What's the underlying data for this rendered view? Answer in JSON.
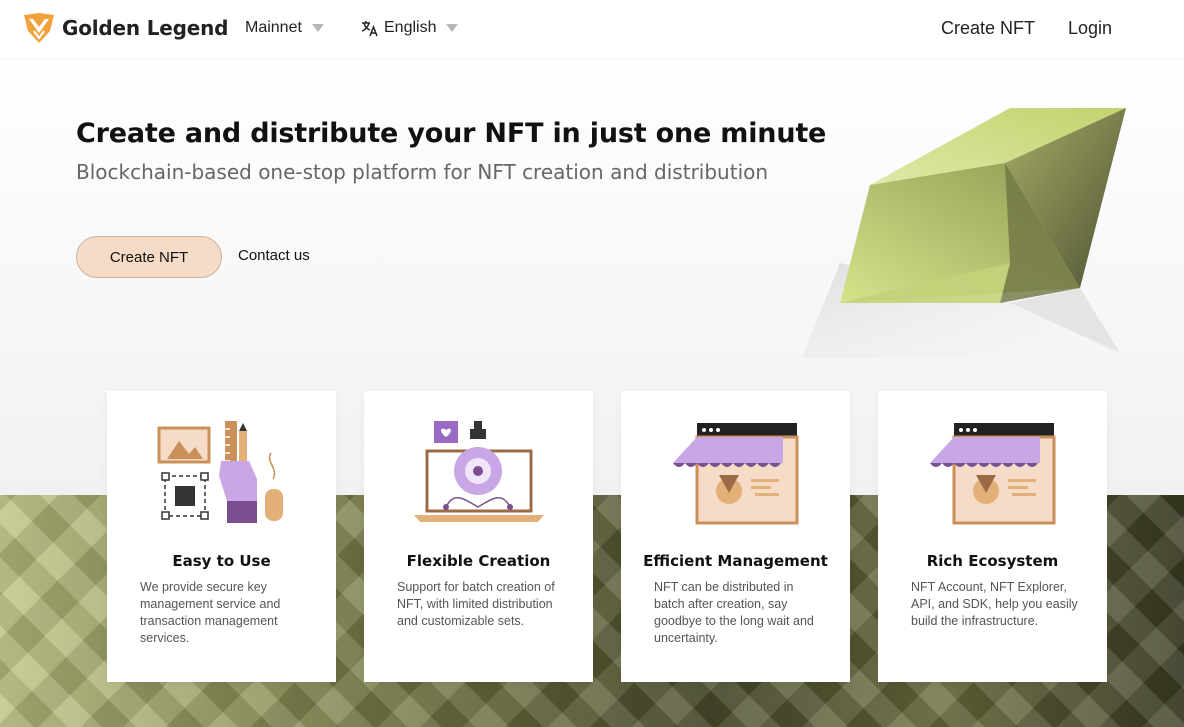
{
  "header": {
    "brand": "Golden Legend",
    "network": "Mainnet",
    "language": "English",
    "create_nft": "Create NFT",
    "login": "Login"
  },
  "hero": {
    "title": "Create and distribute your NFT in just one minute",
    "subtitle": "Blockchain-based one-stop platform for NFT creation and distribution",
    "primary_button": "Create NFT",
    "secondary_link": "Contact us"
  },
  "features": [
    {
      "title": "Easy to Use",
      "description": "We provide secure key management service and transaction management services."
    },
    {
      "title": "Flexible Creation",
      "description": "Support for batch creation of NFT, with limited distribution and customizable sets."
    },
    {
      "title": "Efficient Management",
      "description": "NFT can be distributed in batch after creation, say goodbye to the long wait and uncertainty."
    },
    {
      "title": "Rich Ecosystem",
      "description": "NFT Account, NFT Explorer, API, and SDK, help you easily build the infrastructure."
    }
  ],
  "colors": {
    "accent": "#f6dcc6",
    "brand_orange": "#f0a33a",
    "gem_green": "#b7c96a",
    "illustration_purple": "#c9a6e6",
    "illustration_tan": "#e3b07a"
  },
  "icons": {
    "logo": "shield-logo-icon",
    "language": "translate-icon",
    "dropdown": "caret-down-icon"
  }
}
